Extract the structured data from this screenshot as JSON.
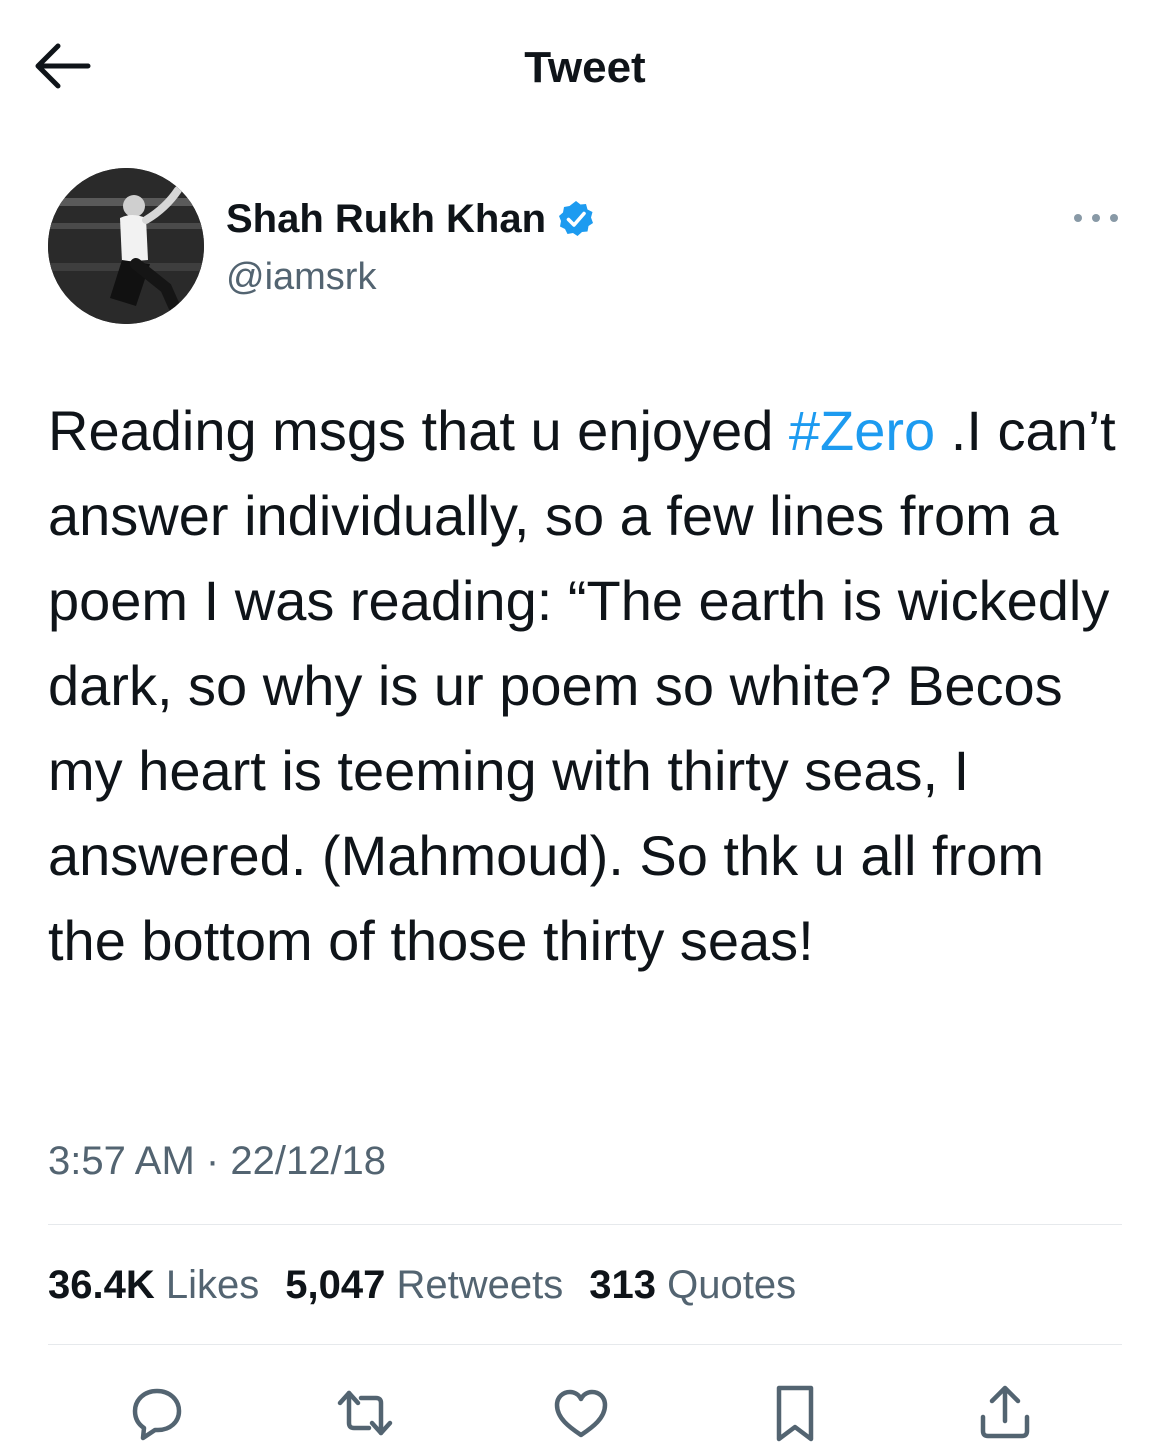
{
  "header": {
    "title": "Tweet",
    "back_icon": "arrow-left-icon"
  },
  "author": {
    "name": "Shah Rukh Khan",
    "handle": "@iamsrk",
    "verified": true,
    "verified_color": "#1d9bf0"
  },
  "tweet": {
    "text_before": "Reading msgs that u enjoyed ",
    "hashtag": "#Zero",
    "text_after": " .I can’t answer individually, so a few lines from a poem I was reading: “The earth is wickedly dark, so why is ur poem so white? Becos my heart is teeming with thirty seas, I answered. (Mahmoud). So thk u all from the bottom of those thirty seas!",
    "time": "3:57 AM",
    "separator": "·",
    "date": "22/12/18"
  },
  "stats": [
    {
      "count": "36.4K",
      "label": "Likes"
    },
    {
      "count": "5,047",
      "label": "Retweets"
    },
    {
      "count": "313",
      "label": "Quotes"
    }
  ],
  "actions": [
    "reply-icon",
    "retweet-icon",
    "like-icon",
    "bookmark-icon",
    "share-icon"
  ],
  "colors": {
    "accent": "#1d9bf0",
    "secondary_text": "#536471",
    "primary_text": "#0f1419",
    "divider": "#e6e9ec"
  }
}
